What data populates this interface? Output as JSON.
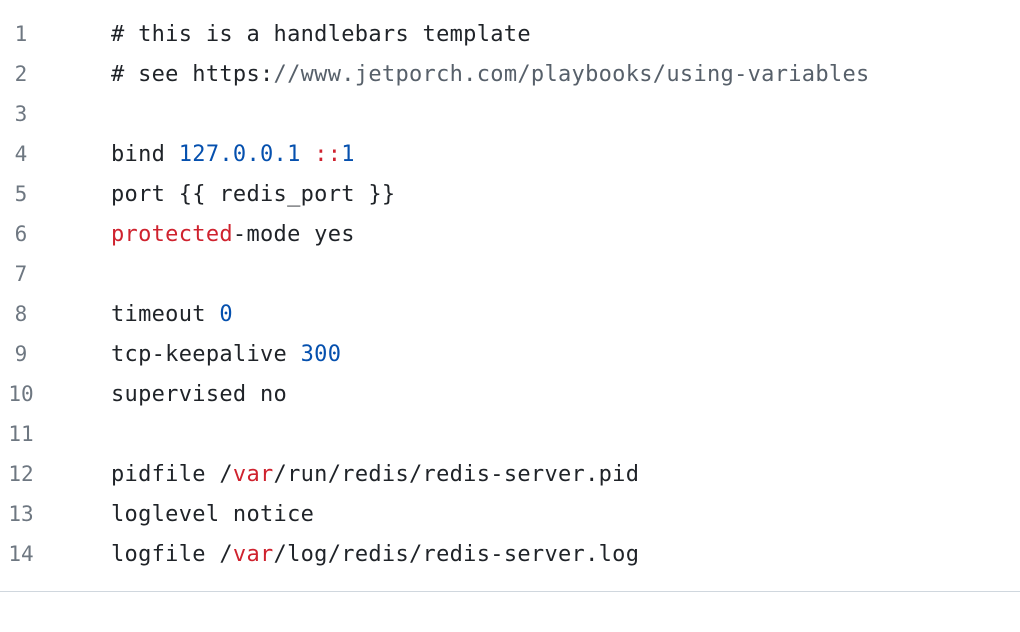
{
  "colors": {
    "text": "#1f2328",
    "line_number": "#6e7781",
    "comment_url": "#57606a",
    "number": "#0550ae",
    "keyword": "#cf222e",
    "divider": "#d0d7de"
  },
  "lines": [
    {
      "number": "1",
      "tokens": [
        {
          "t": "# this is a handlebars template",
          "k": "plain"
        }
      ]
    },
    {
      "number": "2",
      "tokens": [
        {
          "t": "# see https:",
          "k": "plain"
        },
        {
          "t": "//www.jetporch.com/playbooks/using-variables",
          "k": "comment-url"
        }
      ]
    },
    {
      "number": "3",
      "tokens": []
    },
    {
      "number": "4",
      "tokens": [
        {
          "t": "bind ",
          "k": "plain"
        },
        {
          "t": "127.0.0.1",
          "k": "number"
        },
        {
          "t": " ",
          "k": "plain"
        },
        {
          "t": "::",
          "k": "keyword"
        },
        {
          "t": "1",
          "k": "number"
        }
      ]
    },
    {
      "number": "5",
      "tokens": [
        {
          "t": "port {{ redis_port }}",
          "k": "plain"
        }
      ]
    },
    {
      "number": "6",
      "tokens": [
        {
          "t": "protected",
          "k": "keyword"
        },
        {
          "t": "-mode yes",
          "k": "plain"
        }
      ]
    },
    {
      "number": "7",
      "tokens": []
    },
    {
      "number": "8",
      "tokens": [
        {
          "t": "timeout ",
          "k": "plain"
        },
        {
          "t": "0",
          "k": "number"
        }
      ]
    },
    {
      "number": "9",
      "tokens": [
        {
          "t": "tcp-keepalive ",
          "k": "plain"
        },
        {
          "t": "300",
          "k": "number"
        }
      ]
    },
    {
      "number": "10",
      "tokens": [
        {
          "t": "supervised no",
          "k": "plain"
        }
      ]
    },
    {
      "number": "11",
      "tokens": []
    },
    {
      "number": "12",
      "tokens": [
        {
          "t": "pidfile /",
          "k": "plain"
        },
        {
          "t": "var",
          "k": "keyword"
        },
        {
          "t": "/run/redis/redis-server.pid",
          "k": "plain"
        }
      ]
    },
    {
      "number": "13",
      "tokens": [
        {
          "t": "loglevel notice",
          "k": "plain"
        }
      ]
    },
    {
      "number": "14",
      "tokens": [
        {
          "t": "logfile /",
          "k": "plain"
        },
        {
          "t": "var",
          "k": "keyword"
        },
        {
          "t": "/log/redis/redis-server.log",
          "k": "plain"
        }
      ]
    }
  ]
}
